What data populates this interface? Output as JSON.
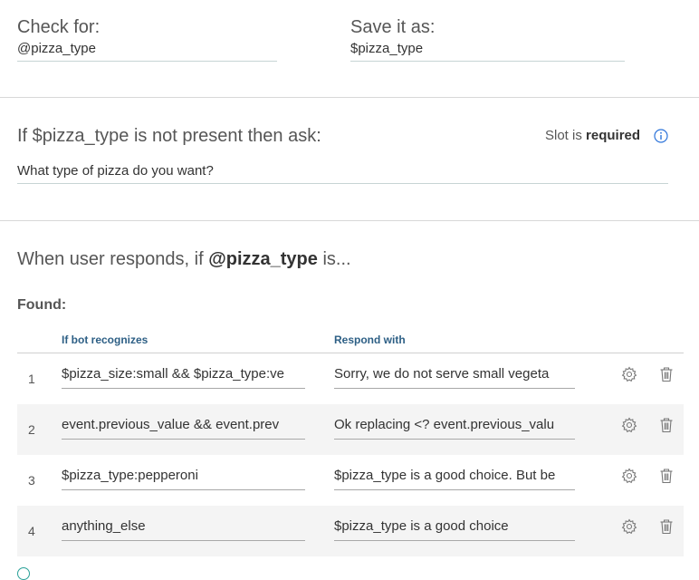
{
  "check": {
    "label": "Check for:",
    "value": "@pizza_type"
  },
  "save": {
    "label": "Save it as:",
    "value": "$pizza_type"
  },
  "prompt": {
    "label": "If $pizza_type is not present then ask:",
    "slot_prefix": "Slot is",
    "slot_status": "required",
    "value": "What type of pizza do you want?"
  },
  "responds": {
    "prefix": "When user responds, if",
    "entity": "@pizza_type",
    "suffix": "is..."
  },
  "found": {
    "label": "Found:",
    "col_recognizes": "If bot recognizes",
    "col_respond": "Respond with",
    "rows": [
      {
        "num": "1",
        "condition": "$pizza_size:small && $pizza_type:ve",
        "response": "Sorry, we do not serve small vegeta"
      },
      {
        "num": "2",
        "condition": "event.previous_value && event.prev",
        "response": "Ok replacing <? event.previous_valu"
      },
      {
        "num": "3",
        "condition": "$pizza_type:pepperoni",
        "response": "$pizza_type is a good choice. But be"
      },
      {
        "num": "4",
        "condition": "anything_else",
        "response": "$pizza_type is a good choice"
      }
    ]
  },
  "colors": {
    "accent": "#2d74da",
    "header_text": "#2d5f85",
    "row_shade": "#f4f4f4"
  },
  "icons": {
    "info": "info-icon",
    "gear": "gear-icon",
    "trash": "trash-icon"
  }
}
